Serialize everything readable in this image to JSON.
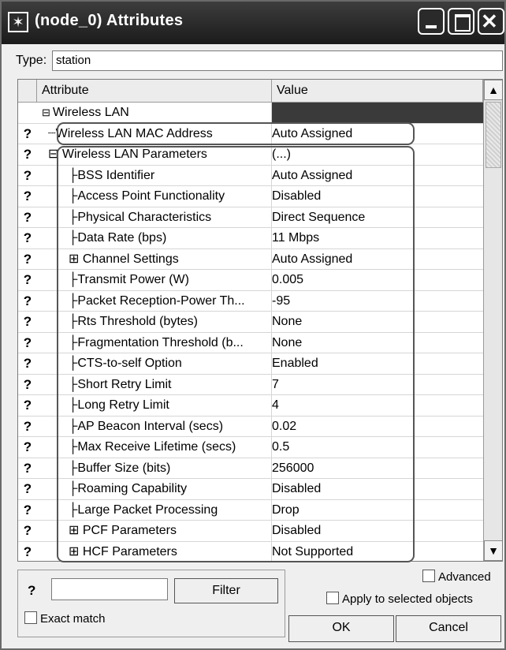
{
  "window": {
    "title": "(node_0) Attributes",
    "app_icon_glyph": "✶"
  },
  "type": {
    "label": "Type:",
    "value": "station"
  },
  "grid": {
    "headers": {
      "attribute": "Attribute",
      "value": "Value"
    },
    "group": {
      "expander": "⊟",
      "label": "Wireless LAN"
    },
    "rows": [
      {
        "prefix": "┈",
        "label": "Wireless LAN MAC Address",
        "value": "Auto Assigned"
      },
      {
        "prefix": "⊟ ",
        "label": "Wireless LAN Parameters",
        "value": "(...)"
      },
      {
        "prefix": "├",
        "label": "BSS Identifier",
        "value": "Auto Assigned"
      },
      {
        "prefix": "├",
        "label": "Access Point Functionality",
        "value": "Disabled"
      },
      {
        "prefix": "├",
        "label": "Physical Characteristics",
        "value": "Direct Sequence"
      },
      {
        "prefix": "├",
        "label": "Data Rate (bps)",
        "value": "11 Mbps"
      },
      {
        "prefix": "⊞ ",
        "label": "Channel Settings",
        "value": "Auto Assigned"
      },
      {
        "prefix": "├",
        "label": "Transmit Power (W)",
        "value": "0.005"
      },
      {
        "prefix": "├",
        "label": "Packet Reception-Power Th...",
        "value": "-95"
      },
      {
        "prefix": "├",
        "label": "Rts Threshold (bytes)",
        "value": "None"
      },
      {
        "prefix": "├",
        "label": "Fragmentation Threshold (b...",
        "value": "None"
      },
      {
        "prefix": "├",
        "label": "CTS-to-self Option",
        "value": "Enabled"
      },
      {
        "prefix": "├",
        "label": "Short Retry Limit",
        "value": "7"
      },
      {
        "prefix": "├",
        "label": "Long Retry Limit",
        "value": "4"
      },
      {
        "prefix": "├",
        "label": "AP Beacon Interval (secs)",
        "value": "0.02"
      },
      {
        "prefix": "├",
        "label": "Max Receive Lifetime (secs)",
        "value": "0.5"
      },
      {
        "prefix": "├",
        "label": "Buffer Size (bits)",
        "value": "256000"
      },
      {
        "prefix": "├",
        "label": "Roaming Capability",
        "value": "Disabled"
      },
      {
        "prefix": "├",
        "label": "Large Packet Processing",
        "value": "Drop"
      },
      {
        "prefix": "⊞ ",
        "label": "PCF Parameters",
        "value": "Disabled"
      },
      {
        "prefix": "⊞ ",
        "label": "HCF Parameters",
        "value": "Not Supported"
      }
    ],
    "help_icon_glyph": "?"
  },
  "bottom": {
    "filter_button": "Filter",
    "exact_match": "Exact match",
    "advanced": "Advanced",
    "apply": "Apply to selected objects",
    "ok": "OK",
    "cancel": "Cancel"
  }
}
